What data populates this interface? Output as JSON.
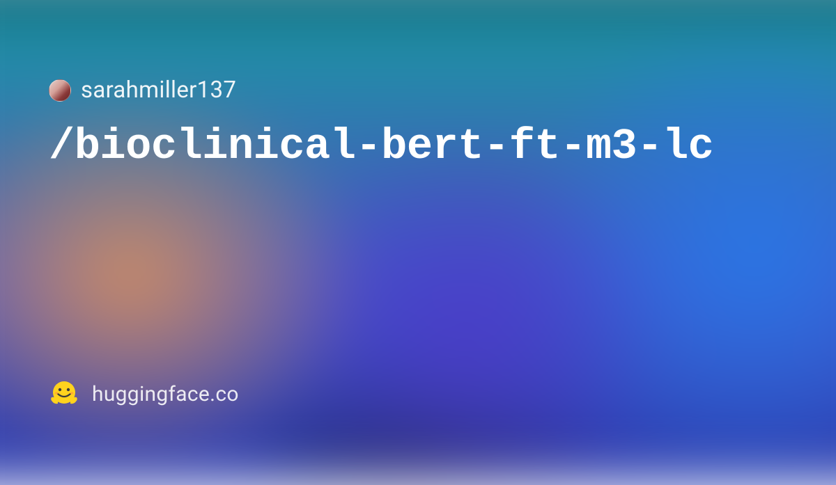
{
  "user": {
    "name": "sarahmiller137"
  },
  "model": {
    "path": "/bioclinical-bert-ft-m3-lc"
  },
  "footer": {
    "site": "huggingface.co"
  }
}
